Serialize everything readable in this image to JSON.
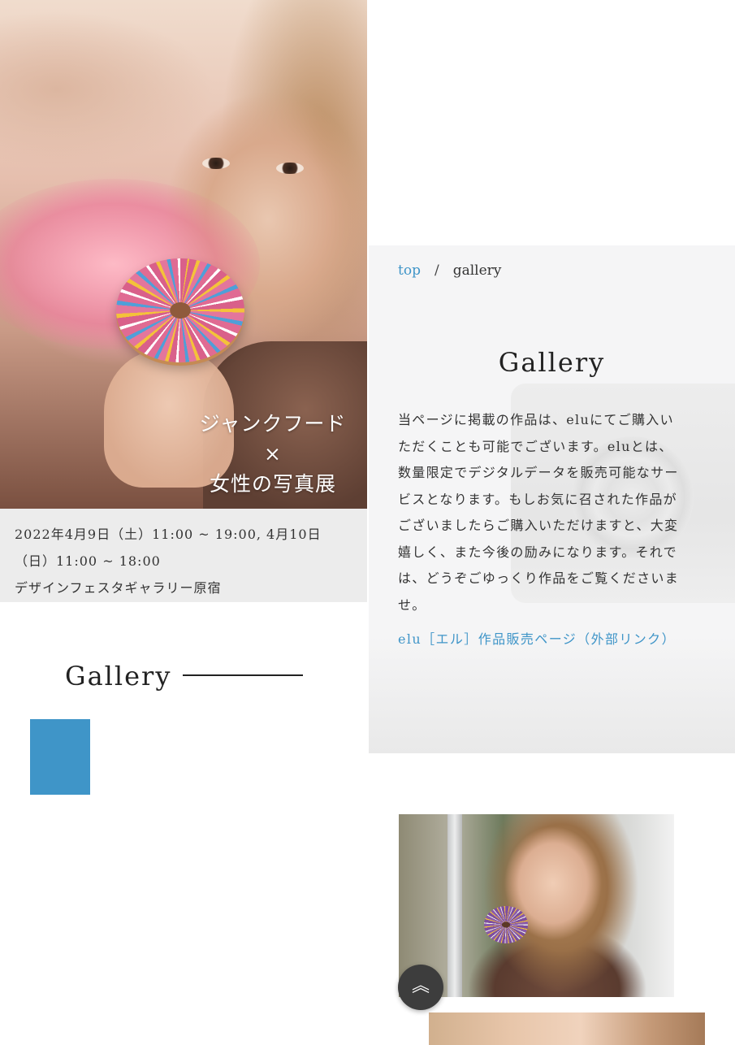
{
  "hero": {
    "title_line1": "ジャンクフード",
    "title_line2": "×",
    "title_line3": "女性の写真展"
  },
  "event": {
    "line1": "2022年4月9日（土）11:00 ~ 19:00, 4月10日",
    "line2": "（日）11:00 ~ 18:00",
    "line3": "デザインフェスタギャラリー原宿"
  },
  "left_section": {
    "heading": "Gallery",
    "accent_color": "#3f95c8"
  },
  "breadcrumb": {
    "home": "top",
    "separator": "/",
    "current": "gallery"
  },
  "gallery": {
    "heading": "Gallery",
    "description_lines": [
      "当ページに掲載の作品は、eluにてご購入い",
      "ただくことも可能でございます。eluとは、",
      "数量限定でデジタルデータを販売可能なサー",
      "ビスとなります。もしお気に召された作品が",
      "ございましたらご購入いただけますと、大変",
      "嬉しく、また今後の励みになります。それで",
      "は、どうぞごゆっくり作品をご覧くださいま",
      "せ。"
    ],
    "elu_link": "elu［エル］作品販売ページ（外部リンク）"
  },
  "scroll_top": {
    "icon": "double-chevron-up-icon",
    "glyph": "︽"
  },
  "colors": {
    "link": "#3f95c8",
    "info_bg": "#ececec",
    "button_bg": "#3d3d3d"
  }
}
